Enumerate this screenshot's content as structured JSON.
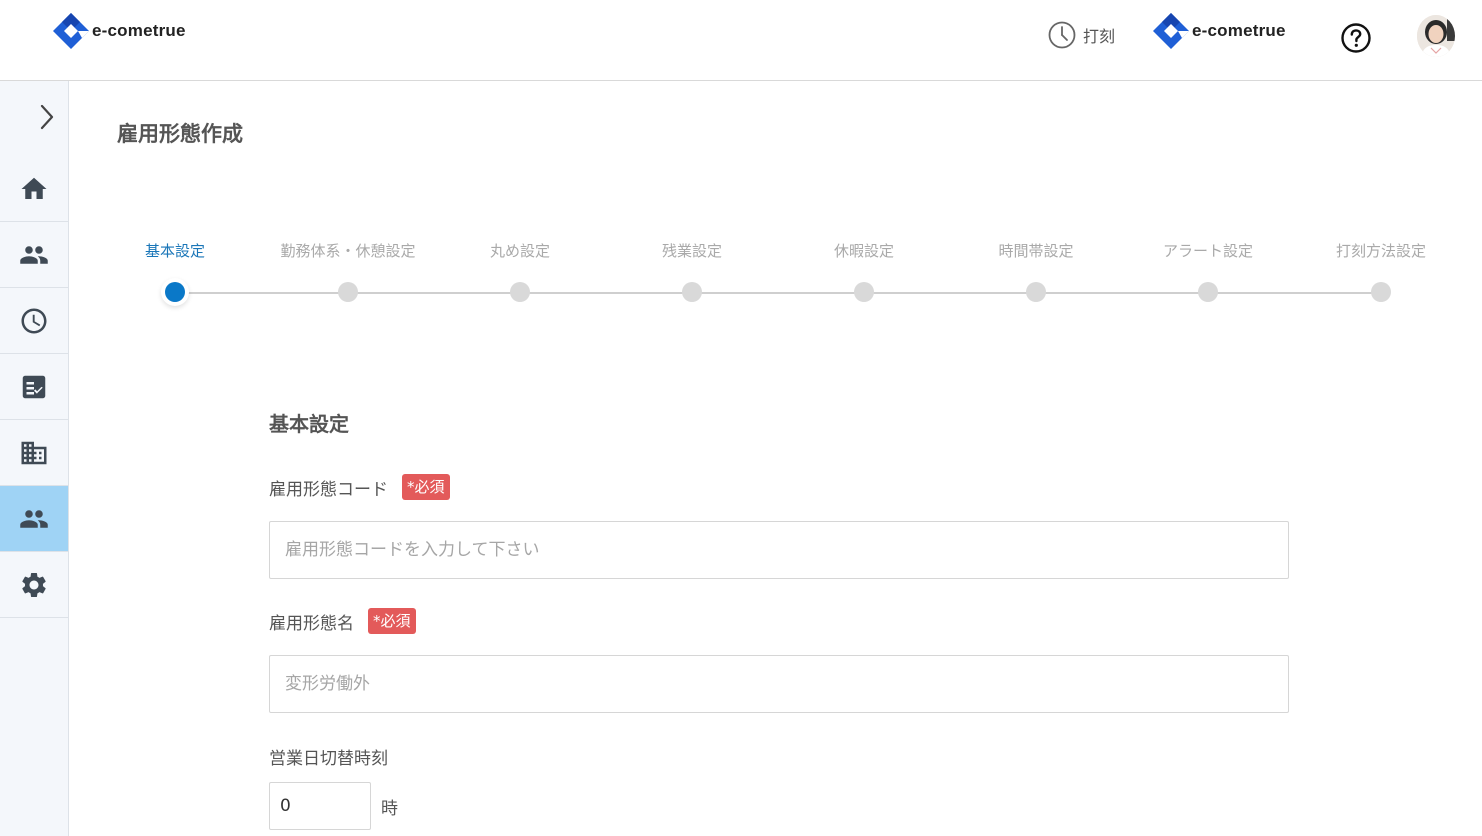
{
  "header": {
    "logo_text": "e-cometrue",
    "punch_label": "打刻",
    "company_logo_text": "e-cometrue",
    "icons": {
      "punch": "clock-icon",
      "help": "question-circle-icon",
      "avatar": "user-avatar"
    }
  },
  "sidebar": {
    "toggle_icon": "chevron-right-icon",
    "items": [
      {
        "icon": "home-icon",
        "active": false
      },
      {
        "icon": "people-icon",
        "active": false
      },
      {
        "icon": "clock-icon",
        "active": false
      },
      {
        "icon": "checklist-icon",
        "active": false
      },
      {
        "icon": "building-icon",
        "active": false
      },
      {
        "icon": "people-icon",
        "active": true
      },
      {
        "icon": "gear-icon",
        "active": false
      }
    ],
    "active_color": "#9fd3f5"
  },
  "page": {
    "title": "雇用形態作成"
  },
  "stepper": {
    "steps": [
      {
        "label": "基本設定",
        "active": true
      },
      {
        "label": "勤務体系・休憩設定",
        "active": false
      },
      {
        "label": "丸め設定",
        "active": false
      },
      {
        "label": "残業設定",
        "active": false
      },
      {
        "label": "休暇設定",
        "active": false
      },
      {
        "label": "時間帯設定",
        "active": false
      },
      {
        "label": "アラート設定",
        "active": false
      },
      {
        "label": "打刻方法設定",
        "active": false
      }
    ],
    "active_color": "#0a78c8"
  },
  "form": {
    "section_title": "基本設定",
    "required_badge": "*必須",
    "code": {
      "label": "雇用形態コード",
      "placeholder": "雇用形態コードを入力して下さい",
      "value": ""
    },
    "name": {
      "label": "雇用形態名",
      "placeholder": "変形労働外",
      "value": ""
    },
    "switch_time": {
      "label": "営業日切替時刻",
      "value": "0",
      "unit": "時"
    },
    "badge_color": "#e35a5a"
  }
}
